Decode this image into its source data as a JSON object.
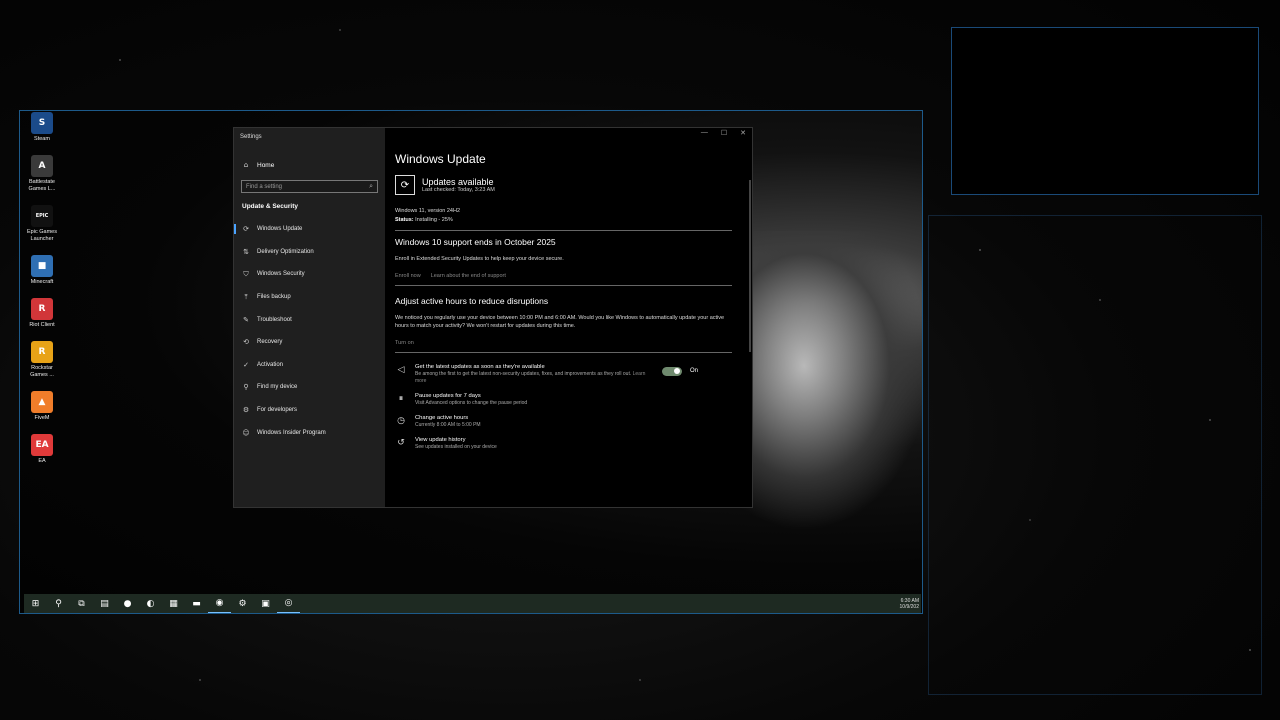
{
  "desktop_icons": [
    {
      "label": "Steam",
      "icon": "steam-icon",
      "color": "#1b4b8a",
      "glyph": "S"
    },
    {
      "label": "Battlestate Games L...",
      "icon": "battlestate-icon",
      "color": "#3a3a3a",
      "glyph": "A"
    },
    {
      "label": "Epic Games Launcher",
      "icon": "epic-games-icon",
      "color": "#111111",
      "glyph": "EPIC"
    },
    {
      "label": "Minecraft",
      "icon": "minecraft-icon",
      "color": "#2f6fb3",
      "glyph": "■"
    },
    {
      "label": "Riot Client",
      "icon": "riot-icon",
      "color": "#d13639",
      "glyph": "R"
    },
    {
      "label": "Rockstar Games ...",
      "icon": "rockstar-icon",
      "color": "#e8a317",
      "glyph": "R"
    },
    {
      "label": "FiveM",
      "icon": "fivem-icon",
      "color": "#f07d2a",
      "glyph": "▲"
    },
    {
      "label": "EA",
      "icon": "ea-icon",
      "color": "#e03a3a",
      "glyph": "EA"
    }
  ],
  "settings": {
    "window_title": "Settings",
    "home": "Home",
    "search_placeholder": "Find a setting",
    "section": "Update & Security",
    "nav": [
      {
        "label": "Windows Update",
        "icon": "sync-icon",
        "glyph": "⟳",
        "active": true
      },
      {
        "label": "Delivery Optimization",
        "icon": "delivery-icon",
        "glyph": "⇅",
        "active": false
      },
      {
        "label": "Windows Security",
        "icon": "shield-icon",
        "glyph": "⛉",
        "active": false
      },
      {
        "label": "Files backup",
        "icon": "backup-icon",
        "glyph": "⤒",
        "active": false
      },
      {
        "label": "Troubleshoot",
        "icon": "wrench-icon",
        "glyph": "✎",
        "active": false
      },
      {
        "label": "Recovery",
        "icon": "recovery-icon",
        "glyph": "⟲",
        "active": false
      },
      {
        "label": "Activation",
        "icon": "activation-icon",
        "glyph": "✓",
        "active": false
      },
      {
        "label": "Find my device",
        "icon": "person-locate-icon",
        "glyph": "⚲",
        "active": false
      },
      {
        "label": "For developers",
        "icon": "developer-icon",
        "glyph": "⚙",
        "active": false
      },
      {
        "label": "Windows Insider Program",
        "icon": "insider-icon",
        "glyph": "☺",
        "active": false
      }
    ],
    "page_title": "Windows Update",
    "status": {
      "title": "Updates available",
      "last_checked": "Last checked: Today, 3:23 AM",
      "version": "Windows 11, version 24H2",
      "status_label": "Status:",
      "status_value": "Installing - 25%"
    },
    "eos": {
      "title": "Windows 10 support ends in October 2025",
      "body": "Enroll in Extended Security Updates to help keep your device secure.",
      "link1": "Enroll now",
      "link2": "Learn about the end of support"
    },
    "active_hours": {
      "title": "Adjust active hours to reduce disruptions",
      "body": "We noticed you regularly use your device between 10:00 PM and 6:00 AM. Would you like Windows to automatically update your active hours to match your activity? We won't restart for updates during this time.",
      "link": "Turn on"
    },
    "options": [
      {
        "title": "Get the latest updates as soon as they're available",
        "sub": "Be among the first to get the latest non-security updates, fixes, and improvements as they roll out.",
        "sub_link": "Learn more",
        "icon": "megaphone-icon",
        "glyph": "◁"
      },
      {
        "title": "Pause updates for 7 days",
        "sub": "Visit Advanced options to change the pause period",
        "icon": "pause-icon",
        "glyph": "⏸"
      },
      {
        "title": "Change active hours",
        "sub": "Currently 8:00 AM to 5:00 PM",
        "icon": "clock-icon",
        "glyph": "◷"
      },
      {
        "title": "View update history",
        "sub": "See updates installed on your device",
        "icon": "history-icon",
        "glyph": "↺"
      }
    ],
    "toggle": {
      "label": "On",
      "checked": true,
      "color": "#6f8a6e"
    }
  },
  "taskbar": {
    "items": [
      {
        "name": "start-button",
        "glyph": "⊞",
        "open": false
      },
      {
        "name": "search-icon",
        "glyph": "⚲",
        "open": false
      },
      {
        "name": "task-view-icon",
        "glyph": "⧉",
        "open": false
      },
      {
        "name": "app-icon",
        "glyph": "▤",
        "open": false
      },
      {
        "name": "vivaldi-icon",
        "glyph": "●",
        "open": false
      },
      {
        "name": "edge-icon",
        "glyph": "◐",
        "open": false
      },
      {
        "name": "store-icon",
        "glyph": "▦",
        "open": false
      },
      {
        "name": "file-explorer-icon",
        "glyph": "▬",
        "open": false
      },
      {
        "name": "chat-icon",
        "glyph": "◉",
        "open": true
      },
      {
        "name": "settings-icon",
        "glyph": "⚙",
        "open": false
      },
      {
        "name": "app-green-icon",
        "glyph": "▣",
        "open": false
      },
      {
        "name": "recording-app-icon",
        "glyph": "◎",
        "open": true
      }
    ],
    "time": "6:30 AM",
    "date": "10/9/202"
  },
  "colors": {
    "accent": "#4aa3ff",
    "frame": "#1d5a8a"
  }
}
